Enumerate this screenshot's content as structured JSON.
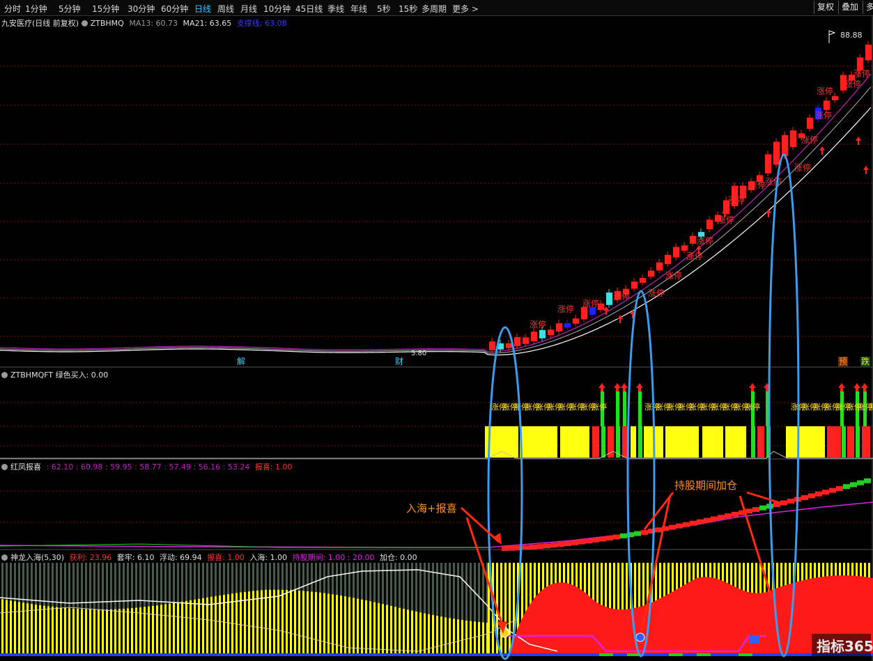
{
  "toolbar": {
    "timeframes": [
      "分时",
      "1分钟",
      "5分钟",
      "15分钟",
      "30分钟",
      "60分钟",
      "日线",
      "周线",
      "月线",
      "10分钟",
      "45日线",
      "季线",
      "年线",
      "5秒",
      "15秒",
      "多周期",
      "更多 >"
    ],
    "active": "日线",
    "buttons": {
      "restore": "复权",
      "overlay": "叠加",
      "more": "多"
    }
  },
  "main_panel": {
    "title": "九安医疗(日线 前复权)",
    "indicator": "ZTBHMQ",
    "ma13_label": "MA13: 60.73",
    "ma21_label": "MA21: 63.65",
    "support_label": "支撑线: 63.08",
    "max_price": "88.88",
    "min_price": "5.80",
    "markers": {
      "jie": "解",
      "cai": "财",
      "yu": "预",
      "die": "跌"
    },
    "zhangting": "涨停"
  },
  "panel2": {
    "title": "ZTBHMQFT 绿色买入: 0.00",
    "label": "涨停"
  },
  "panel3": {
    "title": "红凤报喜",
    "values": ": 62.10 : 60.98 : 59.95 : 58.77 : 57.49 : 56.16 : 53.24",
    "baoxi": "报喜: 1.00",
    "annot1": "入海+报喜",
    "annot2": "持股期间加仓"
  },
  "panel4": {
    "title": "神龙入海(5,30)",
    "huoli": "获利: 23.96",
    "taolao": "套牢: 6.10",
    "fudong": "浮动: 69.94",
    "baoxi": "报喜: 1.00",
    "ruhai": "入海: 1.00",
    "chigu": "持股期间: 1.00 : 20.00",
    "jiacang": "加仓: 0.00"
  },
  "watermark": "指标365",
  "colors": {
    "up": "#ff2020",
    "down": "#2020ff",
    "ma13": "#c020c0",
    "ma21": "#ffffff",
    "grid": "#7a1010",
    "bubble": "#3a9df0",
    "annot": "#ff8a10"
  }
}
